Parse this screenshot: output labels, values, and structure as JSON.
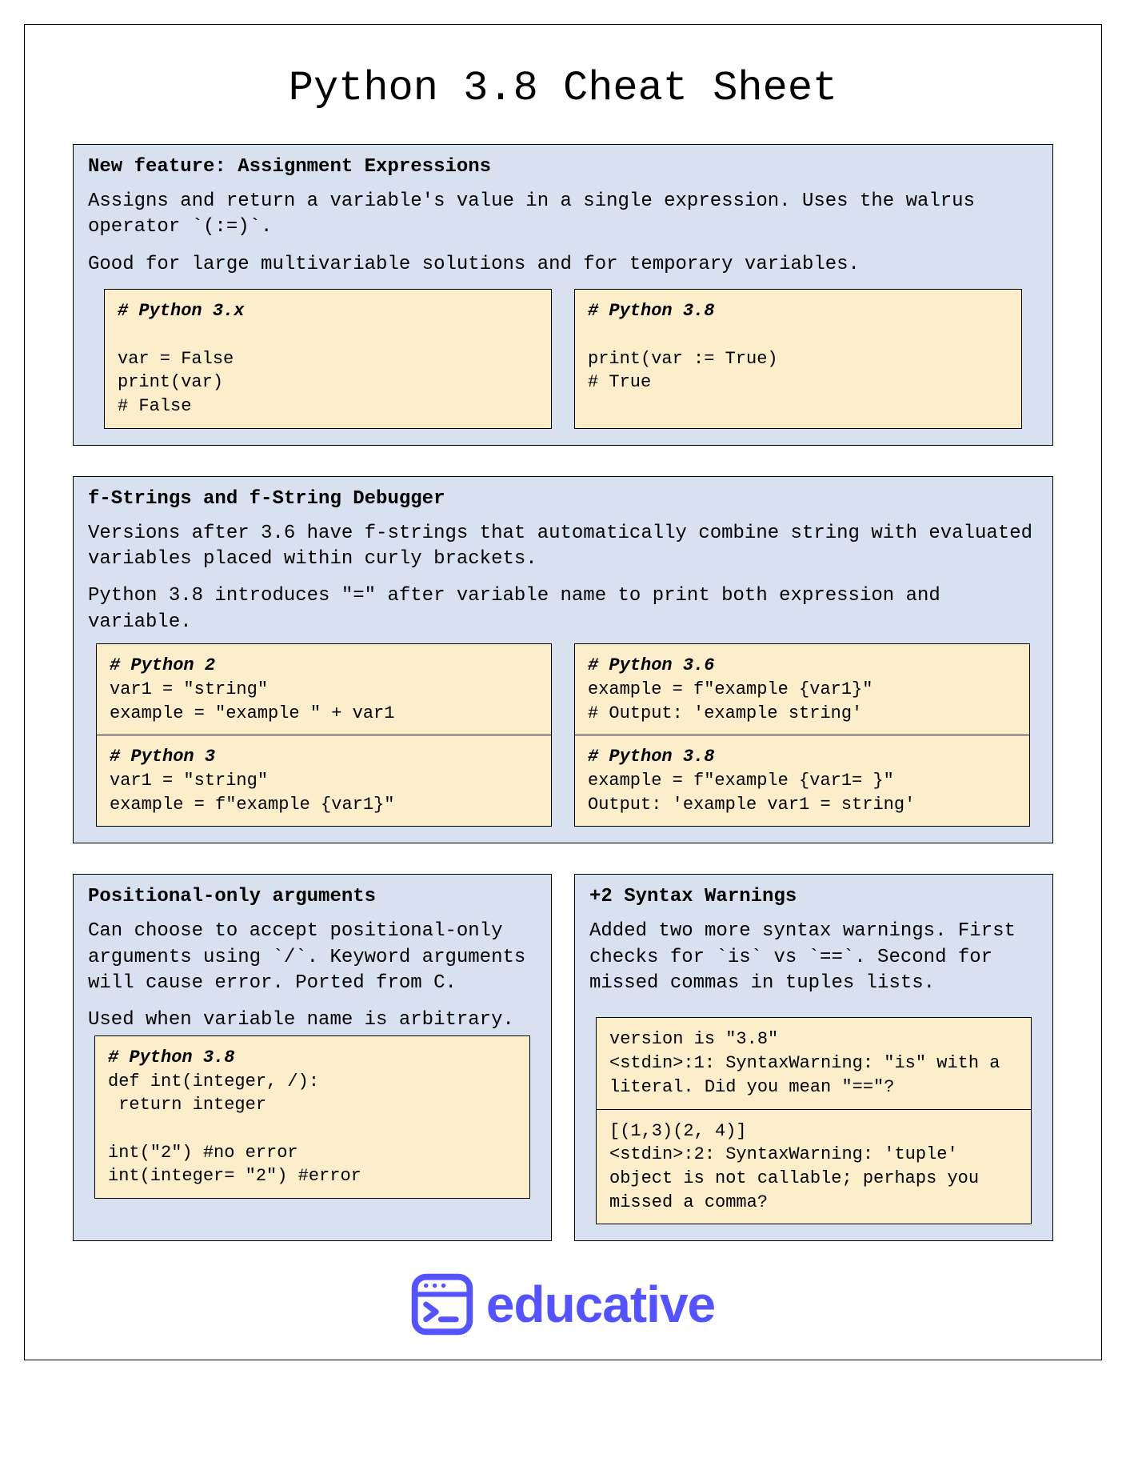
{
  "title": "Python 3.8 Cheat Sheet",
  "section1": {
    "heading": "New feature: Assignment Expressions",
    "p1": "Assigns and return a variable's value in a single expression. Uses the walrus operator `(:=)`.",
    "p2": "Good for large multivariable solutions and for temporary variables.",
    "left_comment": "# Python 3.x",
    "left_code": "var = False\nprint(var)\n# False",
    "right_comment": "# Python 3.8",
    "right_code": "print(var := True)\n# True"
  },
  "section2": {
    "heading": "f-Strings and f-String Debugger",
    "p1": "Versions after 3.6 have f-strings that automatically combine string with evaluated variables placed within curly brackets.",
    "p2": "Python 3.8 introduces \"=\" after variable name to print both expression and variable.",
    "left_top_comment": "# Python 2",
    "left_top_code": "var1 = \"string\"\nexample = \"example \" + var1",
    "left_bot_comment": "# Python 3",
    "left_bot_code": "var1 = \"string\"\nexample = f\"example {var1}\"",
    "right_top_comment": "# Python 3.6",
    "right_top_code": "example = f\"example {var1}\"\n# Output: 'example string'",
    "right_bot_comment": "# Python 3.8",
    "right_bot_code": "example = f\"example {var1= }\"\nOutput: 'example var1 = string'"
  },
  "section3": {
    "heading": "Positional-only arguments",
    "p1": "Can choose to accept positional-only arguments using `/`. Keyword arguments will cause error. Ported from C.",
    "p2": "Used when variable name is arbitrary.",
    "code_comment": "# Python 3.8",
    "code": "def int(integer, /):\n return integer\n\nint(\"2\") #no error\nint(integer= \"2\") #error"
  },
  "section4": {
    "heading": "+2 Syntax Warnings",
    "p1": "Added two more syntax warnings. First checks for `is` vs `==`. Second for missed commas in tuples lists.",
    "code_top": "version is \"3.8\"\n<stdin>:1: SyntaxWarning: \"is\" with a literal. Did you mean \"==\"?",
    "code_bot": "[(1,3)(2, 4)]\n<stdin>:2: SyntaxWarning: 'tuple' object is not callable; perhaps you missed a comma?"
  },
  "brand": "educative"
}
